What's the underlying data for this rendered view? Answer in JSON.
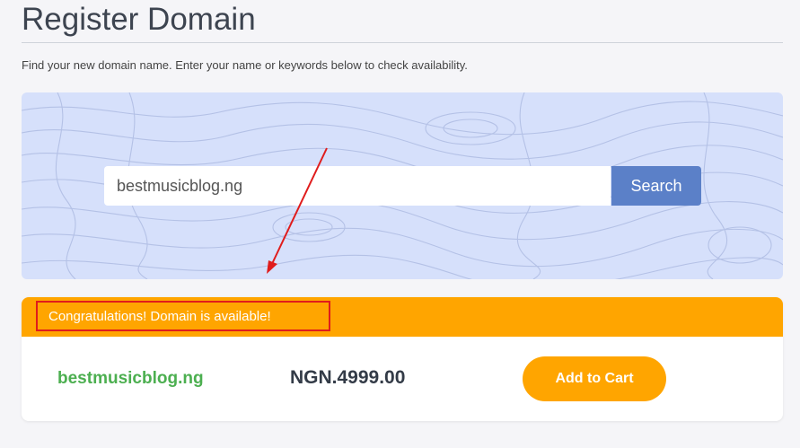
{
  "page": {
    "title": "Register Domain",
    "subtitle": "Find your new domain name. Enter your name or keywords below to check availability."
  },
  "search": {
    "value": "bestmusicblog.ng",
    "button_label": "Search"
  },
  "result": {
    "message": "Congratulations! Domain is available!",
    "domain": "bestmusicblog.ng",
    "price": "NGN.4999.00",
    "add_to_cart_label": "Add to Cart"
  },
  "colors": {
    "accent_orange": "#ffa500",
    "search_button": "#5b80c8",
    "available_green": "#4caf50",
    "annotation_red": "#e01c1c",
    "hero_background": "#d6e0fb"
  },
  "icons": {
    "annotation": "red-arrow-icon"
  }
}
